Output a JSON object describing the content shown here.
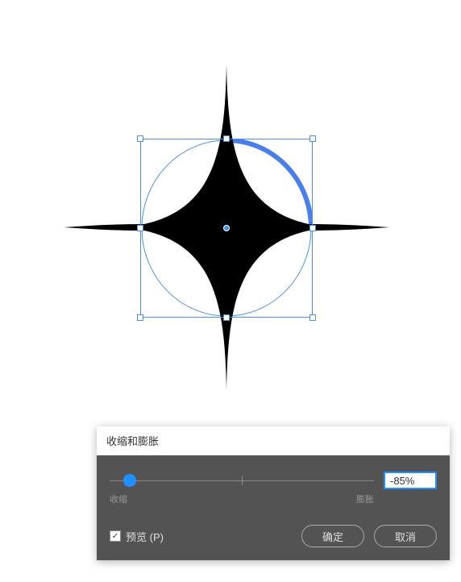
{
  "dialog": {
    "title": "收缩和膨胀",
    "slider": {
      "value": "-85%",
      "left_label": "收缩",
      "right_label": "膨胀"
    },
    "preview_label": "预览 (P)",
    "preview_checked": true,
    "ok_label": "确定",
    "cancel_label": "取消"
  }
}
